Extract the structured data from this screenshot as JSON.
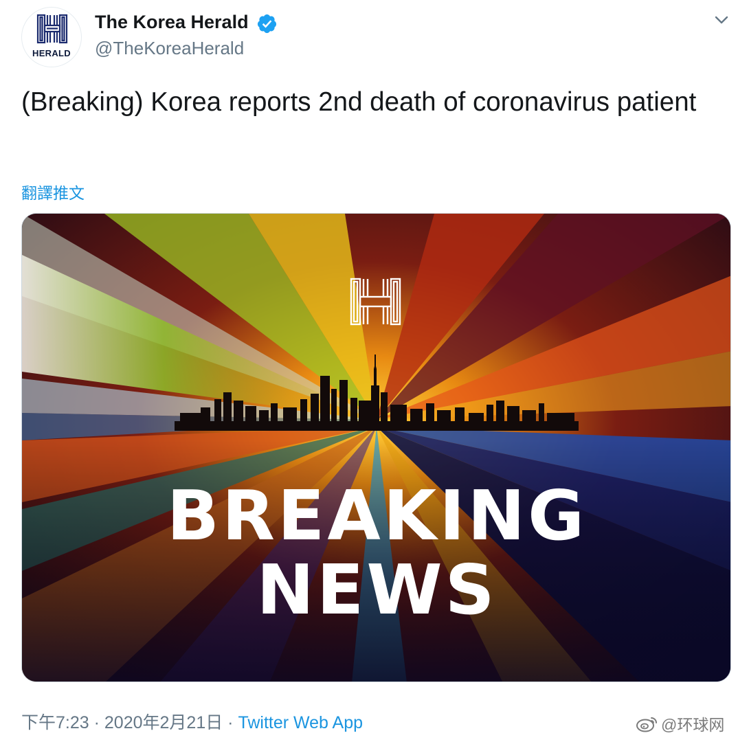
{
  "author": {
    "name": "The Korea Herald",
    "handle": "@TheKoreaHerald",
    "avatar_label": "HERALD",
    "verified": true
  },
  "tweet": {
    "text": "(Breaking) Korea reports 2nd death of coronavirus patient",
    "translate_label": "翻譯推文"
  },
  "media": {
    "headline_line1": "BREAKING",
    "headline_line2": "NEWS",
    "logo_icon": "herald-h-logo-icon",
    "scene": "city-skyline-with-rainbow-light-rays"
  },
  "meta": {
    "time": "下午7:23",
    "separator1": " · ",
    "date": "2020年2月21日",
    "separator2": " · ",
    "source": "Twitter Web App"
  },
  "watermark": {
    "icon": "weibo-icon",
    "text": "@环球网"
  },
  "colors": {
    "link": "#1b95e0",
    "secondary_text": "#657786",
    "verified": "#1da1f2"
  }
}
